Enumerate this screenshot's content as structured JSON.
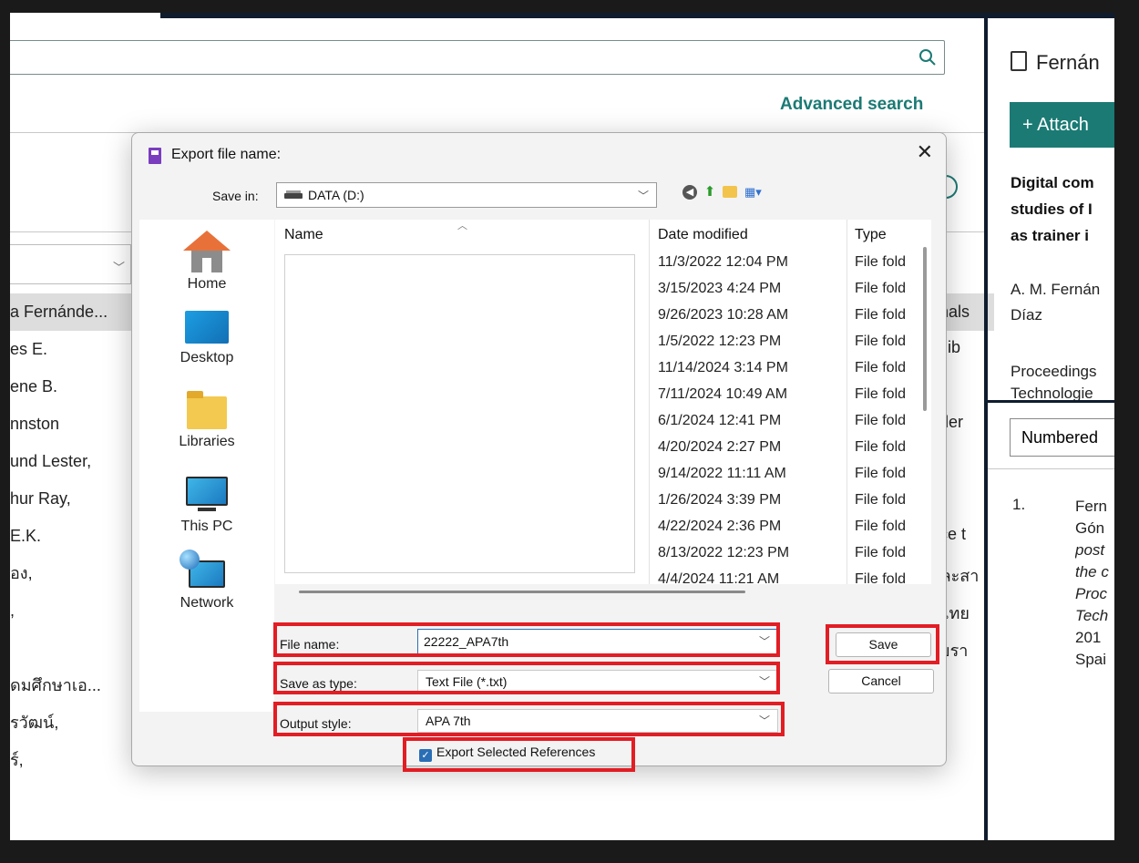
{
  "background": {
    "search_placeholder": "",
    "advanced_search": "Advanced search",
    "authors": [
      "a Fernánde...",
      "es E.",
      "ene B.",
      "nnston",
      "und Lester,",
      "hur Ray,",
      "E.K.",
      "อง,",
      ",",
      "",
      "ดมศึกษาเอ...",
      "รวัฒน์,",
      "ร์,"
    ],
    "right_col_header": "onals",
    "right_col": [
      {
        "text": "h lib",
        "row": 1
      },
      {
        "text": "ader",
        "row": 3
      },
      {
        "text": "nce t",
        "row": 6
      },
      {
        "text": "และสา",
        "row": 7
      },
      {
        "text": "ศไทย",
        "row": 8
      },
      {
        "text": "ลัยรา",
        "row": 9
      }
    ]
  },
  "right_panel": {
    "title": "Fernán",
    "attach": "+  Attach",
    "heading": [
      "Digital com",
      "studies of I",
      "as trainer i"
    ],
    "authors": [
      "A. M. Fernán",
      "Díaz"
    ],
    "proceedings": [
      "Proceedings",
      "Technologie"
    ],
    "citation_style": "Numbered",
    "citation_number": "1.",
    "citation": [
      "Fern",
      "Gón",
      "post",
      "the c",
      "Proc",
      "Tech",
      "201",
      "Spai"
    ]
  },
  "dialog": {
    "title": "Export file name:",
    "close": "✕",
    "save_in_label": "Save in:",
    "save_in_value": "DATA (D:)",
    "places": [
      "Home",
      "Desktop",
      "Libraries",
      "This PC",
      "Network"
    ],
    "columns": {
      "name": "Name",
      "date": "Date modified",
      "type": "Type"
    },
    "rows": [
      {
        "date": "11/3/2022 12:04 PM",
        "type": "File fold"
      },
      {
        "date": "3/15/2023 4:24 PM",
        "type": "File fold"
      },
      {
        "date": "9/26/2023 10:28 AM",
        "type": "File fold"
      },
      {
        "date": "1/5/2022 12:23 PM",
        "type": "File fold"
      },
      {
        "date": "11/14/2024 3:14 PM",
        "type": "File fold"
      },
      {
        "date": "7/11/2024 10:49 AM",
        "type": "File fold"
      },
      {
        "date": "6/1/2024 12:41 PM",
        "type": "File fold"
      },
      {
        "date": "4/20/2024 2:27 PM",
        "type": "File fold"
      },
      {
        "date": "9/14/2022 11:11 AM",
        "type": "File fold"
      },
      {
        "date": "1/26/2024 3:39 PM",
        "type": "File fold"
      },
      {
        "date": "4/22/2024 2:36 PM",
        "type": "File fold"
      },
      {
        "date": "8/13/2022 12:23 PM",
        "type": "File fold"
      },
      {
        "date": "4/4/2024 11:21 AM",
        "type": "File fold"
      }
    ],
    "file_name_label": "File name:",
    "file_name_value": "22222_APA7th",
    "save_as_type_label": "Save as type:",
    "save_as_type_value": "Text File (*.txt)",
    "output_style_label": "Output style:",
    "output_style_value": "APA 7th",
    "export_selected_label": "Export Selected References",
    "export_selected_checked": true,
    "save_button": "Save",
    "cancel_button": "Cancel"
  },
  "colors": {
    "accent": "#1b7a74",
    "highlight": "#e21d24",
    "dialog_bg": "#f3f3f3"
  }
}
